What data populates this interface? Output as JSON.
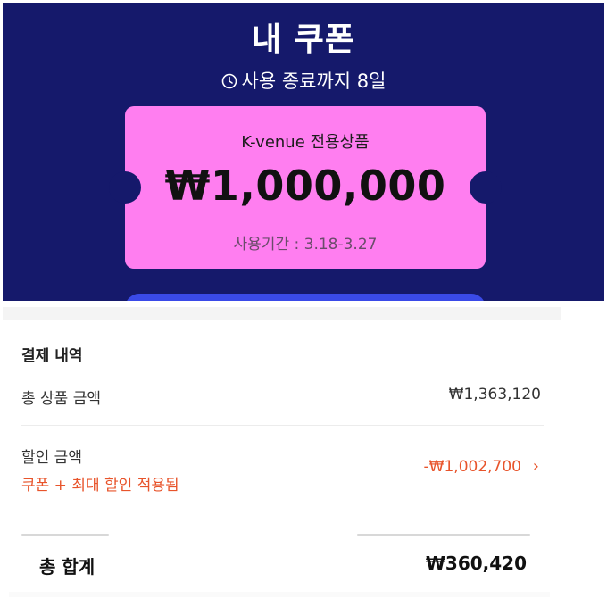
{
  "coupon": {
    "title": "내 쿠폰",
    "expiry_text": "사용 종료까지 8일",
    "expiry_icon": "clock-icon",
    "ticket": {
      "tag": "K-venue 전용상품",
      "amount": "₩1,000,000",
      "period": "사용기간 : 3.18-3.27"
    },
    "colors": {
      "background": "#15196b",
      "ticket": "#ff7ef0",
      "button": "#3a4ae8"
    }
  },
  "payment": {
    "section_title": "결제 내역",
    "rows": [
      {
        "label": "총 상품 금액",
        "value": "₩1,363,120"
      }
    ],
    "discount": {
      "label": "할인 금액",
      "note": "쿠폰 + 최대 할인 적용됨",
      "value": "-₩1,002,700",
      "chevron_icon": "chevron-right-icon",
      "color": "#e8542b"
    },
    "total": {
      "label": "총 합계",
      "value": "₩360,420"
    }
  }
}
